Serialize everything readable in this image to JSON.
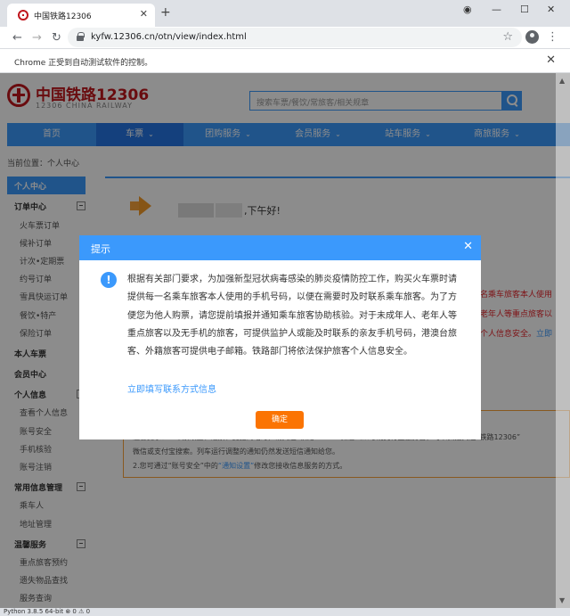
{
  "browser": {
    "tab_title": "中国铁路12306",
    "url": "kyfw.12306.cn/otn/view/index.html",
    "infobar_message": "Chrome 正受到自动测试软件的控制。"
  },
  "header": {
    "logo_cn": "中国铁路12306",
    "logo_en": "12306 CHINA RAILWAY",
    "search_placeholder": "搜索车票/餐饮/常旅客/相关规章"
  },
  "nav": [
    {
      "label": "首页",
      "dropdown": false
    },
    {
      "label": "车票",
      "dropdown": true
    },
    {
      "label": "团购服务",
      "dropdown": true
    },
    {
      "label": "会员服务",
      "dropdown": true
    },
    {
      "label": "站车服务",
      "dropdown": true
    },
    {
      "label": "商旅服务",
      "dropdown": true
    }
  ],
  "breadcrumb": "当前位置：个人中心",
  "sidebar": {
    "active": "个人中心",
    "order_center": "订单中心",
    "order_items": [
      "火车票订单",
      "候补订单",
      "计次•定期票",
      "约号订单",
      "雪具快运订单",
      "餐饮•特产",
      "保险订单"
    ],
    "my_insurance": "本人车票",
    "member_center": "会员中心",
    "personal_info": "个人信息",
    "personal_items": [
      "查看个人信息",
      "账号安全",
      "手机核验",
      "账号注销"
    ],
    "common_info": "常用信息管理",
    "common_items": [
      "乘车人",
      "地址管理"
    ],
    "warm_service": "温馨服务",
    "warm_items": [
      "重点旅客预约",
      "遗失物品查找",
      "服务查询"
    ]
  },
  "welcome": {
    "greeting": ",下午好!"
  },
  "side_texts": {
    "line1": "名乘车旅客本人使用",
    "line2": "老年人等重点旅客以",
    "line3_red": "个人信息安全。",
    "line3_link": "立即"
  },
  "notice": {
    "line1": "温馨提示：1.车票改签、退票、变更到站时，请关注“铁路12306”微信公众号或支付宝服务窗，可以扫描关注“铁路12306”",
    "line2": "微信或支付宝搜索。列车运行调整的通知仍然发送短信通知给您。",
    "line3_prefix": "2.您可通过“账号安全”中的",
    "line3_link": "“通知设置”",
    "line3_suffix": "修改您接收信息服务的方式。"
  },
  "modal": {
    "title": "提示",
    "body": "根据有关部门要求，为加强新型冠状病毒感染的肺炎疫情防控工作，购买火车票时请提供每一名乘车旅客本人使用的手机号码，以便在需要时及时联系乘车旅客。为了方便您为他人购票，请您提前填报并通知乘车旅客协助核验。对于未成年人、老年人等重点旅客以及无手机的旅客，可提供监护人或能及时联系的亲友手机号码，港澳台旅客、外籍旅客可提供电子邮箱。铁路部门将依法保护旅客个人信息安全。",
    "link": "立即填写联系方式信息",
    "ok_label": "确定"
  },
  "status_text": "Python 3.8.5 64-bit   ⊗ 0 ⚠ 0",
  "colors": {
    "primary": "#3b99fc",
    "nav_active": "#2676e3",
    "brand_red": "#c0161d",
    "ok_button": "#fb7403",
    "warning_red": "#e5252b"
  }
}
